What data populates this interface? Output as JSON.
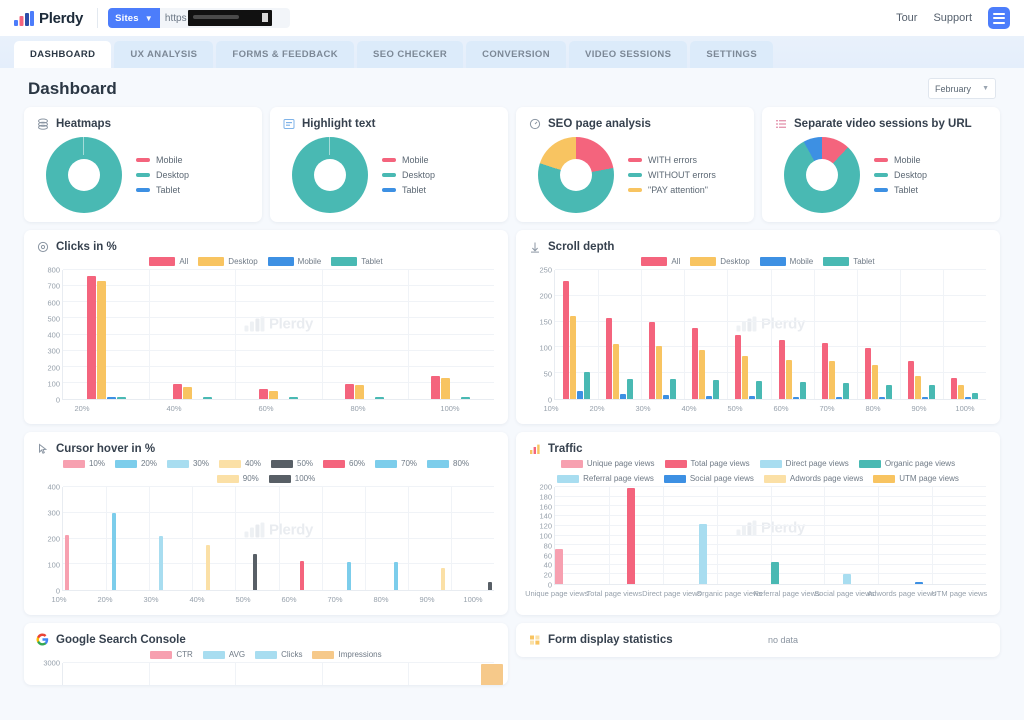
{
  "topbar": {
    "brand": "Plerdy",
    "sites_button": "Sites",
    "sites_caret": "chevron-down-icon",
    "url_prefix": "https",
    "url_value": "",
    "tour": "Tour",
    "support": "Support",
    "menu_icon": "hamburger-menu-icon"
  },
  "tabs": [
    {
      "label": "DASHBOARD",
      "active": true
    },
    {
      "label": "UX ANALYSIS",
      "active": false
    },
    {
      "label": "FORMS & FEEDBACK",
      "active": false
    },
    {
      "label": "SEO CHECKER",
      "active": false
    },
    {
      "label": "CONVERSION",
      "active": false
    },
    {
      "label": "VIDEO SESSIONS",
      "active": false
    },
    {
      "label": "SETTINGS",
      "active": false
    }
  ],
  "page": {
    "title": "Dashboard",
    "month": "February",
    "watermark": "Plerdy",
    "no_data": "no data"
  },
  "colors": {
    "pink": "#f4647d",
    "teal": "#49b9b3",
    "blue": "#3d90e3",
    "yellow": "#f8c461",
    "pink_light": "#f7a0b0",
    "blue_light": "#7ccdeb",
    "blue_lighter": "#a8ddf0",
    "yellow_light": "#fbe0a6",
    "gray_dark": "#585f66",
    "gray": "#b9bec4",
    "orange_light": "#f6c98a",
    "brand_blue": "#4c7dfb"
  },
  "cards": {
    "heatmaps": {
      "title": "Heatmaps",
      "icon": "heatmap-icon",
      "legend": [
        {
          "label": "Mobile",
          "color": "#f4647d"
        },
        {
          "label": "Desktop",
          "color": "#49b9b3"
        },
        {
          "label": "Tablet",
          "color": "#3d90e3"
        }
      ]
    },
    "highlight": {
      "title": "Highlight text",
      "icon": "highlight-text-icon",
      "legend": [
        {
          "label": "Mobile",
          "color": "#f4647d"
        },
        {
          "label": "Desktop",
          "color": "#49b9b3"
        },
        {
          "label": "Tablet",
          "color": "#3d90e3"
        }
      ]
    },
    "seo": {
      "title": "SEO page analysis",
      "icon": "seo-gauge-icon",
      "legend": [
        {
          "label": "WITH errors",
          "color": "#f4647d"
        },
        {
          "label": "WITHOUT errors",
          "color": "#49b9b3"
        },
        {
          "label": "\"PAY attention\"",
          "color": "#f8c461"
        }
      ]
    },
    "video": {
      "title": "Separate video sessions by URL",
      "icon": "list-lines-icon",
      "legend": [
        {
          "label": "Mobile",
          "color": "#f4647d"
        },
        {
          "label": "Desktop",
          "color": "#49b9b3"
        },
        {
          "label": "Tablet",
          "color": "#3d90e3"
        }
      ]
    },
    "clicks": {
      "title": "Clicks in %",
      "icon": "target-icon"
    },
    "scroll": {
      "title": "Scroll depth",
      "icon": "scroll-depth-icon"
    },
    "cursor": {
      "title": "Cursor hover in %",
      "icon": "cursor-icon"
    },
    "traffic": {
      "title": "Traffic",
      "icon": "bar-chart-icon"
    },
    "gsc": {
      "title": "Google Search Console",
      "icon": "google-icon"
    },
    "forms": {
      "title": "Form display statistics",
      "icon": "form-grid-icon"
    }
  },
  "chart_data": [
    {
      "id": "heatmaps_donut",
      "type": "pie",
      "title": "Heatmaps",
      "labels": [
        "Mobile",
        "Desktop",
        "Tablet"
      ],
      "values": [
        0,
        100,
        0
      ],
      "colors": [
        "#f4647d",
        "#49b9b3",
        "#3d90e3"
      ],
      "legend_position": "right"
    },
    {
      "id": "highlight_donut",
      "type": "pie",
      "title": "Highlight text",
      "labels": [
        "Mobile",
        "Desktop",
        "Tablet"
      ],
      "values": [
        0,
        100,
        0
      ],
      "colors": [
        "#f4647d",
        "#49b9b3",
        "#3d90e3"
      ],
      "legend_position": "right"
    },
    {
      "id": "seo_donut",
      "type": "pie",
      "title": "SEO page analysis",
      "labels": [
        "WITH errors",
        "WITHOUT errors",
        "\"PAY attention\""
      ],
      "values": [
        22,
        58,
        20
      ],
      "colors": [
        "#f4647d",
        "#49b9b3",
        "#f8c461"
      ],
      "legend_position": "right"
    },
    {
      "id": "video_donut",
      "type": "pie",
      "title": "Separate video sessions by URL",
      "labels": [
        "Mobile",
        "Desktop",
        "Tablet"
      ],
      "values": [
        12,
        80,
        8
      ],
      "colors": [
        "#f4647d",
        "#49b9b3",
        "#3d90e3"
      ],
      "legend_position": "right"
    },
    {
      "id": "clicks_in_percent",
      "type": "bar",
      "title": "Clicks in %",
      "xlabel": "",
      "ylabel": "",
      "ylim": [
        0,
        800
      ],
      "yticks": [
        0,
        100,
        200,
        300,
        400,
        500,
        600,
        700,
        800
      ],
      "categories": [
        "20%",
        "40%",
        "60%",
        "80%",
        "100%"
      ],
      "legend_position": "top",
      "grid": true,
      "series": [
        {
          "name": "All",
          "color": "#f4647d",
          "values": [
            762,
            92,
            62,
            95,
            145
          ]
        },
        {
          "name": "Desktop",
          "color": "#f8c461",
          "values": [
            733,
            77,
            52,
            88,
            128
          ]
        },
        {
          "name": "Mobile",
          "color": "#3d90e3",
          "values": [
            13,
            0,
            0,
            0,
            0
          ]
        },
        {
          "name": "Tablet",
          "color": "#49b9b3",
          "values": [
            9,
            11,
            7,
            5,
            13
          ]
        }
      ]
    },
    {
      "id": "scroll_depth",
      "type": "bar",
      "title": "Scroll depth",
      "xlabel": "",
      "ylabel": "",
      "ylim": [
        0,
        250
      ],
      "yticks": [
        0,
        50,
        100,
        150,
        200,
        250
      ],
      "categories": [
        "10%",
        "20%",
        "30%",
        "40%",
        "50%",
        "60%",
        "70%",
        "80%",
        "90%",
        "100%"
      ],
      "legend_position": "top",
      "grid": true,
      "series": [
        {
          "name": "All",
          "color": "#f4647d",
          "values": [
            229,
            157,
            150,
            138,
            125,
            114,
            109,
            98,
            73,
            41
          ]
        },
        {
          "name": "Desktop",
          "color": "#f8c461",
          "values": [
            160,
            107,
            102,
            95,
            84,
            76,
            74,
            66,
            44,
            28
          ]
        },
        {
          "name": "Mobile",
          "color": "#3d90e3",
          "values": [
            16,
            10,
            8,
            6,
            5,
            4,
            3,
            3,
            2,
            2
          ]
        },
        {
          "name": "Tablet",
          "color": "#49b9b3",
          "values": [
            52,
            39,
            38,
            37,
            35,
            33,
            32,
            28,
            27,
            11
          ]
        }
      ]
    },
    {
      "id": "cursor_hover_in_percent",
      "type": "bar",
      "title": "Cursor hover in %",
      "xlabel": "",
      "ylabel": "",
      "ylim": [
        0,
        400
      ],
      "yticks": [
        0,
        100,
        200,
        300,
        400
      ],
      "categories": [
        "10%",
        "20%",
        "30%",
        "40%",
        "50%",
        "60%",
        "70%",
        "80%",
        "90%",
        "100%"
      ],
      "legend_position": "top",
      "grid": true,
      "series": [
        {
          "name": "10%",
          "color": "#f7a0b0",
          "values": [
            214,
            0,
            0,
            0,
            0,
            0,
            0,
            0,
            0,
            0
          ]
        },
        {
          "name": "20%",
          "color": "#7ccdeb",
          "values": [
            0,
            301,
            0,
            0,
            0,
            0,
            0,
            0,
            0,
            0
          ]
        },
        {
          "name": "30%",
          "color": "#a8ddf0",
          "values": [
            0,
            0,
            210,
            0,
            0,
            0,
            0,
            0,
            0,
            0
          ]
        },
        {
          "name": "40%",
          "color": "#fbe0a6",
          "values": [
            0,
            0,
            0,
            175,
            0,
            0,
            0,
            0,
            0,
            0
          ]
        },
        {
          "name": "50%",
          "color": "#585f66",
          "values": [
            0,
            0,
            0,
            0,
            140,
            0,
            0,
            0,
            0,
            0
          ]
        },
        {
          "name": "60%",
          "color": "#f4647d",
          "values": [
            0,
            0,
            0,
            0,
            0,
            111,
            0,
            0,
            0,
            0
          ]
        },
        {
          "name": "70%",
          "color": "#7ccdeb",
          "values": [
            0,
            0,
            0,
            0,
            0,
            0,
            107,
            0,
            0,
            0
          ]
        },
        {
          "name": "80%",
          "color": "#7ccdeb",
          "values": [
            0,
            0,
            0,
            0,
            0,
            0,
            0,
            107,
            0,
            0
          ]
        },
        {
          "name": "90%",
          "color": "#fbe0a6",
          "values": [
            0,
            0,
            0,
            0,
            0,
            0,
            0,
            0,
            85,
            0
          ]
        },
        {
          "name": "100%",
          "color": "#585f66",
          "values": [
            0,
            0,
            0,
            0,
            0,
            0,
            0,
            0,
            0,
            30
          ]
        }
      ]
    },
    {
      "id": "traffic",
      "type": "bar",
      "title": "Traffic",
      "xlabel": "",
      "ylabel": "",
      "ylim": [
        0,
        200
      ],
      "yticks": [
        0,
        20,
        40,
        60,
        80,
        100,
        120,
        140,
        160,
        180,
        200
      ],
      "categories": [
        "Unique page views",
        "Total page views",
        "Direct page views",
        "Organic page views",
        "Referral page views",
        "Social page views",
        "Adwords page views",
        "UTM page views"
      ],
      "legend_position": "top",
      "grid": true,
      "series": [
        {
          "name": "Unique page views",
          "color": "#f7a0b0",
          "values": [
            73,
            0,
            0,
            0,
            0,
            0,
            0,
            0
          ]
        },
        {
          "name": "Total page views",
          "color": "#f4647d",
          "values": [
            0,
            197,
            0,
            0,
            0,
            0,
            0,
            0
          ]
        },
        {
          "name": "Direct page views",
          "color": "#a8ddf0",
          "values": [
            0,
            0,
            124,
            0,
            0,
            0,
            0,
            0
          ]
        },
        {
          "name": "Organic page views",
          "color": "#49b9b3",
          "values": [
            0,
            0,
            0,
            45,
            0,
            0,
            0,
            0
          ]
        },
        {
          "name": "Referral page views",
          "color": "#a8ddf0",
          "values": [
            0,
            0,
            0,
            0,
            20,
            0,
            0,
            0
          ]
        },
        {
          "name": "Social page views",
          "color": "#3d90e3",
          "values": [
            0,
            0,
            0,
            0,
            0,
            4,
            0,
            0
          ]
        },
        {
          "name": "Adwords page views",
          "color": "#fbe0a6",
          "values": [
            0,
            0,
            0,
            0,
            0,
            0,
            0,
            0
          ]
        },
        {
          "name": "UTM page views",
          "color": "#f8c461",
          "values": [
            0,
            0,
            0,
            0,
            0,
            0,
            0,
            1
          ]
        }
      ]
    },
    {
      "id": "google_search_console",
      "type": "bar",
      "title": "Google Search Console",
      "xlabel": "",
      "ylabel": "",
      "ylim": [
        0,
        3000
      ],
      "yticks": [
        3000
      ],
      "categories": [
        "",
        "",
        "",
        "",
        ""
      ],
      "legend_position": "top",
      "grid": true,
      "series": [
        {
          "name": "CTR",
          "color": "#f7a0b0",
          "values": [
            0,
            0,
            0,
            0,
            0
          ]
        },
        {
          "name": "AVG",
          "color": "#a8ddf0",
          "values": [
            0,
            0,
            0,
            0,
            0
          ]
        },
        {
          "name": "Clicks",
          "color": "#a8ddf0",
          "values": [
            0,
            0,
            0,
            0,
            0
          ]
        },
        {
          "name": "Impressions",
          "color": "#f6c98a",
          "values": [
            0,
            0,
            0,
            0,
            2900
          ]
        }
      ]
    }
  ]
}
